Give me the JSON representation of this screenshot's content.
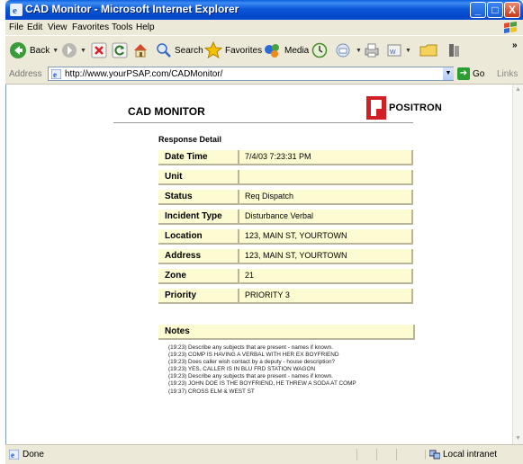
{
  "window": {
    "title": "CAD Monitor - Microsoft Internet Explorer",
    "controls": {
      "minimize": "_",
      "maximize": "□",
      "close": "X"
    }
  },
  "menu": {
    "items": [
      "File",
      "Edit",
      "View",
      "Favorites",
      "Tools",
      "Help"
    ]
  },
  "toolbar": {
    "back_label": "Back",
    "search_label": "Search",
    "favorites_label": "Favorites",
    "media_label": "Media",
    "more": "»"
  },
  "address": {
    "label": "Address",
    "url": "http://www.yourPSAP.com/CADMonitor/",
    "go_label": "Go",
    "links_label": "Links"
  },
  "page": {
    "heading": "CAD MONITOR",
    "logo_text": "POSITRON",
    "section_title": "Response Detail",
    "fields": [
      {
        "label": "Date Time",
        "value": "7/4/03 7:23:31 PM"
      },
      {
        "label": "Unit",
        "value": ""
      },
      {
        "label": "Status",
        "value": "Req Dispatch"
      },
      {
        "label": "Incident Type",
        "value": "Disturbance Verbal"
      },
      {
        "label": "Location",
        "value": "123, MAIN ST, YOURTOWN"
      },
      {
        "label": "Address",
        "value": "123, MAIN ST, YOURTOWN"
      },
      {
        "label": "Zone",
        "value": "21"
      },
      {
        "label": "Priority",
        "value": "PRIORITY 3"
      }
    ],
    "notes_title": "Notes",
    "notes": [
      "(19:23) Describe any subjects that are present - names if known.",
      "(19:23) COMP IS HAVING A VERBAL WITH HER EX BOYFRIEND",
      "(19:23) Does caller wish contact by a deputy - house description?",
      "(19:23) YES, CALLER IS IN BLU FRD STATION WAGON",
      "(19:23) Describe any subjects that are present - names if known.",
      "(19:23) JOHN DOE IS THE BOYFRIEND, HE THREW A SODA AT COMP",
      "(19:37) CROSS ELM & WEST ST"
    ]
  },
  "status": {
    "left_text": "Done",
    "zone_text": "Local intranet"
  }
}
